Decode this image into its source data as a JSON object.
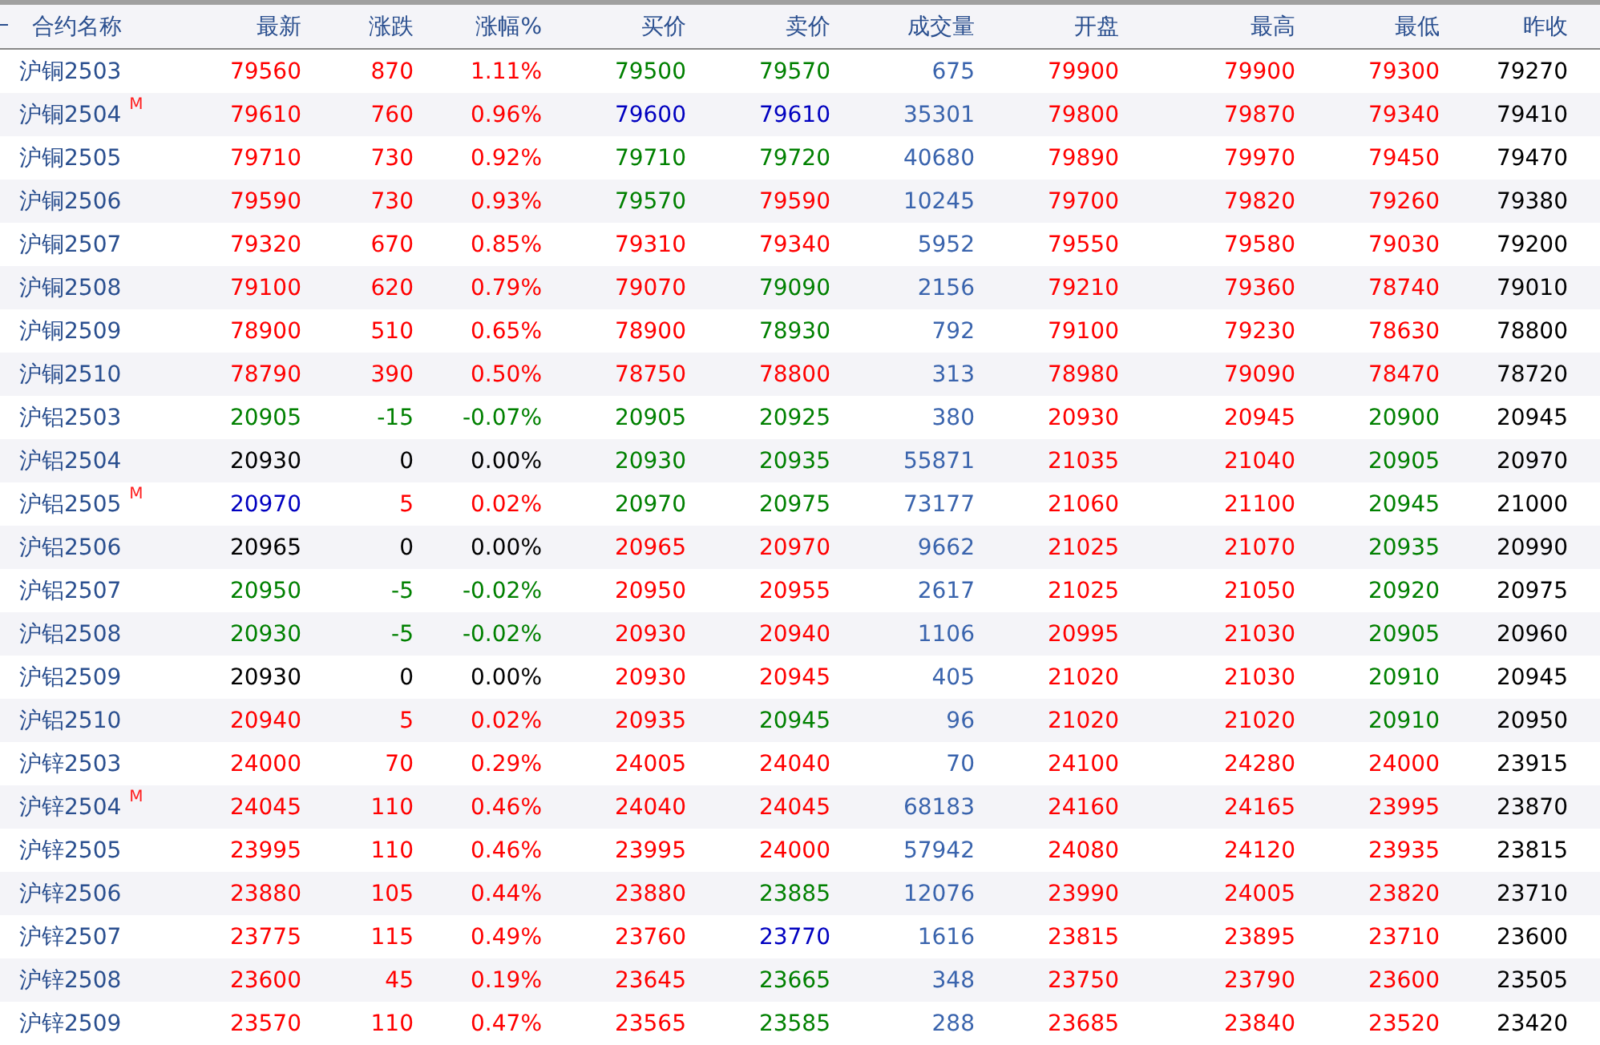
{
  "table": {
    "columns": [
      "合约名称",
      "最新",
      "涨跌",
      "涨幅%",
      "买价",
      "卖价",
      "成交量",
      "开盘",
      "最高",
      "最低",
      "昨收"
    ],
    "rows": [
      {
        "cells": [
          {
            "text": "沪铜2503"
          },
          {
            "text": "79560",
            "color": "#ff0000"
          },
          {
            "text": "870",
            "color": "#ff0000"
          },
          {
            "text": "1.11%",
            "color": "#ff0000"
          },
          {
            "text": "79500",
            "color": "#008000"
          },
          {
            "text": "79570",
            "color": "#008000"
          },
          {
            "text": "675",
            "color": "#3a64ad"
          },
          {
            "text": "79900",
            "color": "#ff0000"
          },
          {
            "text": "79900",
            "color": "#ff0000"
          },
          {
            "text": "79300",
            "color": "#ff0000"
          },
          {
            "text": "79270",
            "color": "#000000"
          }
        ]
      },
      {
        "cells": [
          {
            "text": "沪铜2504",
            "badge": "M"
          },
          {
            "text": "79610",
            "color": "#ff0000"
          },
          {
            "text": "760",
            "color": "#ff0000"
          },
          {
            "text": "0.96%",
            "color": "#ff0000"
          },
          {
            "text": "79600",
            "color": "#0000c0"
          },
          {
            "text": "79610",
            "color": "#0000c0"
          },
          {
            "text": "35301",
            "color": "#3a64ad"
          },
          {
            "text": "79800",
            "color": "#ff0000"
          },
          {
            "text": "79870",
            "color": "#ff0000"
          },
          {
            "text": "79340",
            "color": "#ff0000"
          },
          {
            "text": "79410",
            "color": "#000000"
          }
        ]
      },
      {
        "cells": [
          {
            "text": "沪铜2505"
          },
          {
            "text": "79710",
            "color": "#ff0000"
          },
          {
            "text": "730",
            "color": "#ff0000"
          },
          {
            "text": "0.92%",
            "color": "#ff0000"
          },
          {
            "text": "79710",
            "color": "#008000"
          },
          {
            "text": "79720",
            "color": "#008000"
          },
          {
            "text": "40680",
            "color": "#3a64ad"
          },
          {
            "text": "79890",
            "color": "#ff0000"
          },
          {
            "text": "79970",
            "color": "#ff0000"
          },
          {
            "text": "79450",
            "color": "#ff0000"
          },
          {
            "text": "79470",
            "color": "#000000"
          }
        ]
      },
      {
        "cells": [
          {
            "text": "沪铜2506"
          },
          {
            "text": "79590",
            "color": "#ff0000"
          },
          {
            "text": "730",
            "color": "#ff0000"
          },
          {
            "text": "0.93%",
            "color": "#ff0000"
          },
          {
            "text": "79570",
            "color": "#008000"
          },
          {
            "text": "79590",
            "color": "#ff0000"
          },
          {
            "text": "10245",
            "color": "#3a64ad"
          },
          {
            "text": "79700",
            "color": "#ff0000"
          },
          {
            "text": "79820",
            "color": "#ff0000"
          },
          {
            "text": "79260",
            "color": "#ff0000"
          },
          {
            "text": "79380",
            "color": "#000000"
          }
        ]
      },
      {
        "cells": [
          {
            "text": "沪铜2507"
          },
          {
            "text": "79320",
            "color": "#ff0000"
          },
          {
            "text": "670",
            "color": "#ff0000"
          },
          {
            "text": "0.85%",
            "color": "#ff0000"
          },
          {
            "text": "79310",
            "color": "#ff0000"
          },
          {
            "text": "79340",
            "color": "#ff0000"
          },
          {
            "text": "5952",
            "color": "#3a64ad"
          },
          {
            "text": "79550",
            "color": "#ff0000"
          },
          {
            "text": "79580",
            "color": "#ff0000"
          },
          {
            "text": "79030",
            "color": "#ff0000"
          },
          {
            "text": "79200",
            "color": "#000000"
          }
        ]
      },
      {
        "cells": [
          {
            "text": "沪铜2508"
          },
          {
            "text": "79100",
            "color": "#ff0000"
          },
          {
            "text": "620",
            "color": "#ff0000"
          },
          {
            "text": "0.79%",
            "color": "#ff0000"
          },
          {
            "text": "79070",
            "color": "#ff0000"
          },
          {
            "text": "79090",
            "color": "#008000"
          },
          {
            "text": "2156",
            "color": "#3a64ad"
          },
          {
            "text": "79210",
            "color": "#ff0000"
          },
          {
            "text": "79360",
            "color": "#ff0000"
          },
          {
            "text": "78740",
            "color": "#ff0000"
          },
          {
            "text": "79010",
            "color": "#000000"
          }
        ]
      },
      {
        "cells": [
          {
            "text": "沪铜2509"
          },
          {
            "text": "78900",
            "color": "#ff0000"
          },
          {
            "text": "510",
            "color": "#ff0000"
          },
          {
            "text": "0.65%",
            "color": "#ff0000"
          },
          {
            "text": "78900",
            "color": "#ff0000"
          },
          {
            "text": "78930",
            "color": "#008000"
          },
          {
            "text": "792",
            "color": "#3a64ad"
          },
          {
            "text": "79100",
            "color": "#ff0000"
          },
          {
            "text": "79230",
            "color": "#ff0000"
          },
          {
            "text": "78630",
            "color": "#ff0000"
          },
          {
            "text": "78800",
            "color": "#000000"
          }
        ]
      },
      {
        "cells": [
          {
            "text": "沪铜2510"
          },
          {
            "text": "78790",
            "color": "#ff0000"
          },
          {
            "text": "390",
            "color": "#ff0000"
          },
          {
            "text": "0.50%",
            "color": "#ff0000"
          },
          {
            "text": "78750",
            "color": "#ff0000"
          },
          {
            "text": "78800",
            "color": "#ff0000"
          },
          {
            "text": "313",
            "color": "#3a64ad"
          },
          {
            "text": "78980",
            "color": "#ff0000"
          },
          {
            "text": "79090",
            "color": "#ff0000"
          },
          {
            "text": "78470",
            "color": "#ff0000"
          },
          {
            "text": "78720",
            "color": "#000000"
          }
        ]
      },
      {
        "cells": [
          {
            "text": "沪铝2503"
          },
          {
            "text": "20905",
            "color": "#008000"
          },
          {
            "text": "-15",
            "color": "#008000"
          },
          {
            "text": "-0.07%",
            "color": "#008000"
          },
          {
            "text": "20905",
            "color": "#008000"
          },
          {
            "text": "20925",
            "color": "#008000"
          },
          {
            "text": "380",
            "color": "#3a64ad"
          },
          {
            "text": "20930",
            "color": "#ff0000"
          },
          {
            "text": "20945",
            "color": "#ff0000"
          },
          {
            "text": "20900",
            "color": "#008000"
          },
          {
            "text": "20945",
            "color": "#000000"
          }
        ]
      },
      {
        "cells": [
          {
            "text": "沪铝2504"
          },
          {
            "text": "20930",
            "color": "#000000"
          },
          {
            "text": "0",
            "color": "#000000"
          },
          {
            "text": "0.00%",
            "color": "#000000"
          },
          {
            "text": "20930",
            "color": "#008000"
          },
          {
            "text": "20935",
            "color": "#008000"
          },
          {
            "text": "55871",
            "color": "#3a64ad"
          },
          {
            "text": "21035",
            "color": "#ff0000"
          },
          {
            "text": "21040",
            "color": "#ff0000"
          },
          {
            "text": "20905",
            "color": "#008000"
          },
          {
            "text": "20970",
            "color": "#000000"
          }
        ]
      },
      {
        "cells": [
          {
            "text": "沪铝2505",
            "badge": "M"
          },
          {
            "text": "20970",
            "color": "#0000c0"
          },
          {
            "text": "5",
            "color": "#ff0000"
          },
          {
            "text": "0.02%",
            "color": "#ff0000"
          },
          {
            "text": "20970",
            "color": "#008000"
          },
          {
            "text": "20975",
            "color": "#008000"
          },
          {
            "text": "73177",
            "color": "#3a64ad"
          },
          {
            "text": "21060",
            "color": "#ff0000"
          },
          {
            "text": "21100",
            "color": "#ff0000"
          },
          {
            "text": "20945",
            "color": "#008000"
          },
          {
            "text": "21000",
            "color": "#000000"
          }
        ]
      },
      {
        "cells": [
          {
            "text": "沪铝2506"
          },
          {
            "text": "20965",
            "color": "#000000"
          },
          {
            "text": "0",
            "color": "#000000"
          },
          {
            "text": "0.00%",
            "color": "#000000"
          },
          {
            "text": "20965",
            "color": "#ff0000"
          },
          {
            "text": "20970",
            "color": "#ff0000"
          },
          {
            "text": "9662",
            "color": "#3a64ad"
          },
          {
            "text": "21025",
            "color": "#ff0000"
          },
          {
            "text": "21070",
            "color": "#ff0000"
          },
          {
            "text": "20935",
            "color": "#008000"
          },
          {
            "text": "20990",
            "color": "#000000"
          }
        ]
      },
      {
        "cells": [
          {
            "text": "沪铝2507"
          },
          {
            "text": "20950",
            "color": "#008000"
          },
          {
            "text": "-5",
            "color": "#008000"
          },
          {
            "text": "-0.02%",
            "color": "#008000"
          },
          {
            "text": "20950",
            "color": "#ff0000"
          },
          {
            "text": "20955",
            "color": "#ff0000"
          },
          {
            "text": "2617",
            "color": "#3a64ad"
          },
          {
            "text": "21025",
            "color": "#ff0000"
          },
          {
            "text": "21050",
            "color": "#ff0000"
          },
          {
            "text": "20920",
            "color": "#008000"
          },
          {
            "text": "20975",
            "color": "#000000"
          }
        ]
      },
      {
        "cells": [
          {
            "text": "沪铝2508"
          },
          {
            "text": "20930",
            "color": "#008000"
          },
          {
            "text": "-5",
            "color": "#008000"
          },
          {
            "text": "-0.02%",
            "color": "#008000"
          },
          {
            "text": "20930",
            "color": "#ff0000"
          },
          {
            "text": "20940",
            "color": "#ff0000"
          },
          {
            "text": "1106",
            "color": "#3a64ad"
          },
          {
            "text": "20995",
            "color": "#ff0000"
          },
          {
            "text": "21030",
            "color": "#ff0000"
          },
          {
            "text": "20905",
            "color": "#008000"
          },
          {
            "text": "20960",
            "color": "#000000"
          }
        ]
      },
      {
        "cells": [
          {
            "text": "沪铝2509"
          },
          {
            "text": "20930",
            "color": "#000000"
          },
          {
            "text": "0",
            "color": "#000000"
          },
          {
            "text": "0.00%",
            "color": "#000000"
          },
          {
            "text": "20930",
            "color": "#ff0000"
          },
          {
            "text": "20945",
            "color": "#ff0000"
          },
          {
            "text": "405",
            "color": "#3a64ad"
          },
          {
            "text": "21020",
            "color": "#ff0000"
          },
          {
            "text": "21030",
            "color": "#ff0000"
          },
          {
            "text": "20910",
            "color": "#008000"
          },
          {
            "text": "20945",
            "color": "#000000"
          }
        ]
      },
      {
        "cells": [
          {
            "text": "沪铝2510"
          },
          {
            "text": "20940",
            "color": "#ff0000"
          },
          {
            "text": "5",
            "color": "#ff0000"
          },
          {
            "text": "0.02%",
            "color": "#ff0000"
          },
          {
            "text": "20935",
            "color": "#ff0000"
          },
          {
            "text": "20945",
            "color": "#008000"
          },
          {
            "text": "96",
            "color": "#3a64ad"
          },
          {
            "text": "21020",
            "color": "#ff0000"
          },
          {
            "text": "21020",
            "color": "#ff0000"
          },
          {
            "text": "20910",
            "color": "#008000"
          },
          {
            "text": "20950",
            "color": "#000000"
          }
        ]
      },
      {
        "cells": [
          {
            "text": "沪锌2503"
          },
          {
            "text": "24000",
            "color": "#ff0000"
          },
          {
            "text": "70",
            "color": "#ff0000"
          },
          {
            "text": "0.29%",
            "color": "#ff0000"
          },
          {
            "text": "24005",
            "color": "#ff0000"
          },
          {
            "text": "24040",
            "color": "#ff0000"
          },
          {
            "text": "70",
            "color": "#3a64ad"
          },
          {
            "text": "24100",
            "color": "#ff0000"
          },
          {
            "text": "24280",
            "color": "#ff0000"
          },
          {
            "text": "24000",
            "color": "#ff0000"
          },
          {
            "text": "23915",
            "color": "#000000"
          }
        ]
      },
      {
        "cells": [
          {
            "text": "沪锌2504",
            "badge": "M"
          },
          {
            "text": "24045",
            "color": "#ff0000"
          },
          {
            "text": "110",
            "color": "#ff0000"
          },
          {
            "text": "0.46%",
            "color": "#ff0000"
          },
          {
            "text": "24040",
            "color": "#ff0000"
          },
          {
            "text": "24045",
            "color": "#ff0000"
          },
          {
            "text": "68183",
            "color": "#3a64ad"
          },
          {
            "text": "24160",
            "color": "#ff0000"
          },
          {
            "text": "24165",
            "color": "#ff0000"
          },
          {
            "text": "23995",
            "color": "#ff0000"
          },
          {
            "text": "23870",
            "color": "#000000"
          }
        ]
      },
      {
        "cells": [
          {
            "text": "沪锌2505"
          },
          {
            "text": "23995",
            "color": "#ff0000"
          },
          {
            "text": "110",
            "color": "#ff0000"
          },
          {
            "text": "0.46%",
            "color": "#ff0000"
          },
          {
            "text": "23995",
            "color": "#ff0000"
          },
          {
            "text": "24000",
            "color": "#ff0000"
          },
          {
            "text": "57942",
            "color": "#3a64ad"
          },
          {
            "text": "24080",
            "color": "#ff0000"
          },
          {
            "text": "24120",
            "color": "#ff0000"
          },
          {
            "text": "23935",
            "color": "#ff0000"
          },
          {
            "text": "23815",
            "color": "#000000"
          }
        ]
      },
      {
        "cells": [
          {
            "text": "沪锌2506"
          },
          {
            "text": "23880",
            "color": "#ff0000"
          },
          {
            "text": "105",
            "color": "#ff0000"
          },
          {
            "text": "0.44%",
            "color": "#ff0000"
          },
          {
            "text": "23880",
            "color": "#ff0000"
          },
          {
            "text": "23885",
            "color": "#008000"
          },
          {
            "text": "12076",
            "color": "#3a64ad"
          },
          {
            "text": "23990",
            "color": "#ff0000"
          },
          {
            "text": "24005",
            "color": "#ff0000"
          },
          {
            "text": "23820",
            "color": "#ff0000"
          },
          {
            "text": "23710",
            "color": "#000000"
          }
        ]
      },
      {
        "cells": [
          {
            "text": "沪锌2507"
          },
          {
            "text": "23775",
            "color": "#ff0000"
          },
          {
            "text": "115",
            "color": "#ff0000"
          },
          {
            "text": "0.49%",
            "color": "#ff0000"
          },
          {
            "text": "23760",
            "color": "#ff0000"
          },
          {
            "text": "23770",
            "color": "#0000c0"
          },
          {
            "text": "1616",
            "color": "#3a64ad"
          },
          {
            "text": "23815",
            "color": "#ff0000"
          },
          {
            "text": "23895",
            "color": "#ff0000"
          },
          {
            "text": "23710",
            "color": "#ff0000"
          },
          {
            "text": "23600",
            "color": "#000000"
          }
        ]
      },
      {
        "cells": [
          {
            "text": "沪锌2508"
          },
          {
            "text": "23600",
            "color": "#ff0000"
          },
          {
            "text": "45",
            "color": "#ff0000"
          },
          {
            "text": "0.19%",
            "color": "#ff0000"
          },
          {
            "text": "23645",
            "color": "#ff0000"
          },
          {
            "text": "23665",
            "color": "#008000"
          },
          {
            "text": "348",
            "color": "#3a64ad"
          },
          {
            "text": "23750",
            "color": "#ff0000"
          },
          {
            "text": "23790",
            "color": "#ff0000"
          },
          {
            "text": "23600",
            "color": "#ff0000"
          },
          {
            "text": "23505",
            "color": "#000000"
          }
        ]
      },
      {
        "cells": [
          {
            "text": "沪锌2509"
          },
          {
            "text": "23570",
            "color": "#ff0000"
          },
          {
            "text": "110",
            "color": "#ff0000"
          },
          {
            "text": "0.47%",
            "color": "#ff0000"
          },
          {
            "text": "23565",
            "color": "#ff0000"
          },
          {
            "text": "23585",
            "color": "#008000"
          },
          {
            "text": "288",
            "color": "#3a64ad"
          },
          {
            "text": "23685",
            "color": "#ff0000"
          },
          {
            "text": "23840",
            "color": "#ff0000"
          },
          {
            "text": "23520",
            "color": "#ff0000"
          },
          {
            "text": "23420",
            "color": "#000000"
          }
        ]
      }
    ]
  }
}
